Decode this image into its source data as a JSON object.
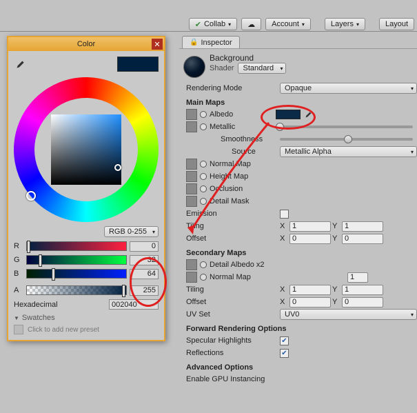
{
  "toolbar": {
    "collab": "Collab",
    "account": "Account",
    "layers": "Layers",
    "layout": "Layout"
  },
  "inspector": {
    "tab": "Inspector",
    "material_name": "Background",
    "shader_label": "Shader",
    "shader_value": "Standard",
    "rendering_mode_label": "Rendering Mode",
    "rendering_mode_value": "Opaque",
    "main_maps": "Main Maps",
    "albedo": "Albedo",
    "albedo_color": "#0a2a48",
    "metallic": "Metallic",
    "metallic_value": 0,
    "smoothness_label": "Smoothness",
    "smoothness_value": 0.5,
    "source_label": "Source",
    "source_value": "Metallic Alpha",
    "normal_map": "Normal Map",
    "height_map": "Height Map",
    "occlusion": "Occlusion",
    "detail_mask": "Detail Mask",
    "emission": "Emission",
    "emission_checked": false,
    "tiling": "Tiling",
    "offset": "Offset",
    "tiling_x": "1",
    "tiling_y": "1",
    "offset_x": "0",
    "offset_y": "0",
    "secondary_maps": "Secondary Maps",
    "detail_albedo": "Detail Albedo x2",
    "normal_map2": "Normal Map",
    "normal_map2_value": "1",
    "tiling2_x": "1",
    "tiling2_y": "1",
    "offset2_x": "0",
    "offset2_y": "0",
    "uv_set_label": "UV Set",
    "uv_set_value": "UV0",
    "forward_opts": "Forward Rendering Options",
    "specular_highlights": "Specular Highlights",
    "specular_checked": true,
    "reflections": "Reflections",
    "reflections_checked": true,
    "advanced": "Advanced Options",
    "gpu_instancing": "Enable GPU Instancing",
    "x_label": "X",
    "y_label": "Y"
  },
  "color_picker": {
    "title": "Color",
    "mode": "RGB 0-255",
    "r_label": "R",
    "r_value": "0",
    "g_label": "G",
    "g_value": "32",
    "b_label": "B",
    "b_value": "64",
    "a_label": "A",
    "a_value": "255",
    "hex_label": "Hexadecimal",
    "hex_value": "002040",
    "swatches": "Swatches",
    "preset_hint": "Click to add new preset",
    "current_color": "#002040"
  },
  "chart_data": null
}
